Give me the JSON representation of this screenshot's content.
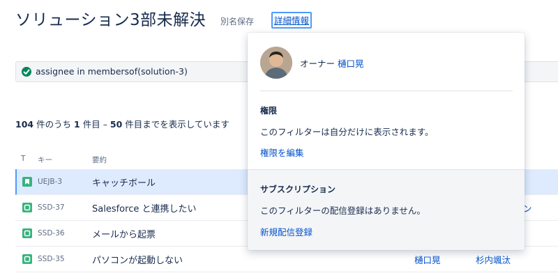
{
  "header": {
    "title": "ソリューション3部未解決",
    "save_as": "別名保存",
    "details": "詳細情報"
  },
  "jql": {
    "status_icon": "check-circle-icon",
    "query": "assignee in membersof(solution-3)"
  },
  "results": {
    "total": "104",
    "text_a": " 件のうち ",
    "from": "1",
    "text_b": " 件目 – ",
    "to": "50",
    "text_c": " 件目までを表示しています"
  },
  "columns": {
    "type": "T",
    "key": "キー",
    "summary": "要約"
  },
  "rows": [
    {
      "key": "UEJB-3",
      "summary": "キャッチボール",
      "icon": "story-icon",
      "assignee": "",
      "reporter": ""
    },
    {
      "key": "SSD-37",
      "summary": "Salesforce と連携したい",
      "icon": "service-request-icon",
      "assignee": "",
      "reporter": "ン"
    },
    {
      "key": "SSD-36",
      "summary": "メールから起票",
      "icon": "service-request-icon",
      "assignee": "",
      "reporter": ""
    },
    {
      "key": "SSD-35",
      "summary": "パソコンが起動しない",
      "icon": "service-request-icon",
      "assignee": "樋口晃",
      "reporter": "杉内颯汰"
    }
  ],
  "popover": {
    "owner_label": "オーナー",
    "owner_name": "樋口晃",
    "permissions_title": "権限",
    "permissions_text": "このフィルターは自分だけに表示されます。",
    "permissions_link": "権限を編集",
    "subscription_title": "サブスクリプション",
    "subscription_text": "このフィルターの配信登録はありません。",
    "subscription_link": "新規配信登録"
  },
  "colors": {
    "link": "#0052cc",
    "text": "#172b4d",
    "success": "#00875a",
    "selected_row": "#deebff",
    "focus": "#4c9aff"
  }
}
